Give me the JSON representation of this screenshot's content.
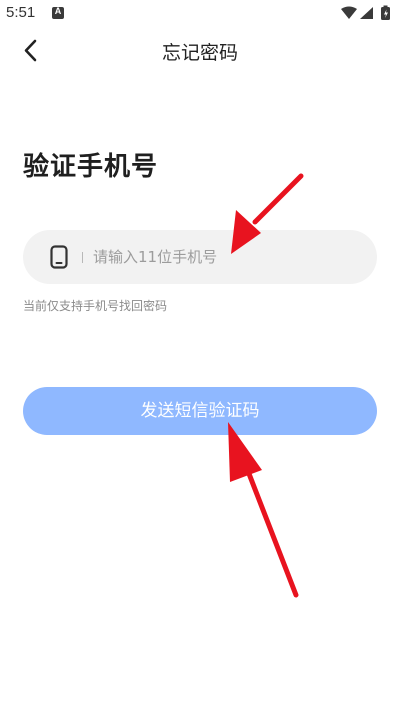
{
  "status_bar": {
    "time": "5:51",
    "icons": [
      "notification-a-icon",
      "wifi-icon",
      "signal-icon",
      "battery-icon"
    ]
  },
  "header": {
    "back_icon": "chevron-left-icon",
    "title": "忘记密码"
  },
  "main": {
    "heading": "验证手机号",
    "phone_input": {
      "icon": "phone-icon",
      "value": "",
      "placeholder": "请输入11位手机号"
    },
    "hint": "当前仅支持手机号找回密码",
    "send_button_label": "发送短信验证码"
  },
  "colors": {
    "accent_button": "#8fb8ff",
    "input_background": "#f2f2f2",
    "annotation_arrow": "#e8131f"
  }
}
